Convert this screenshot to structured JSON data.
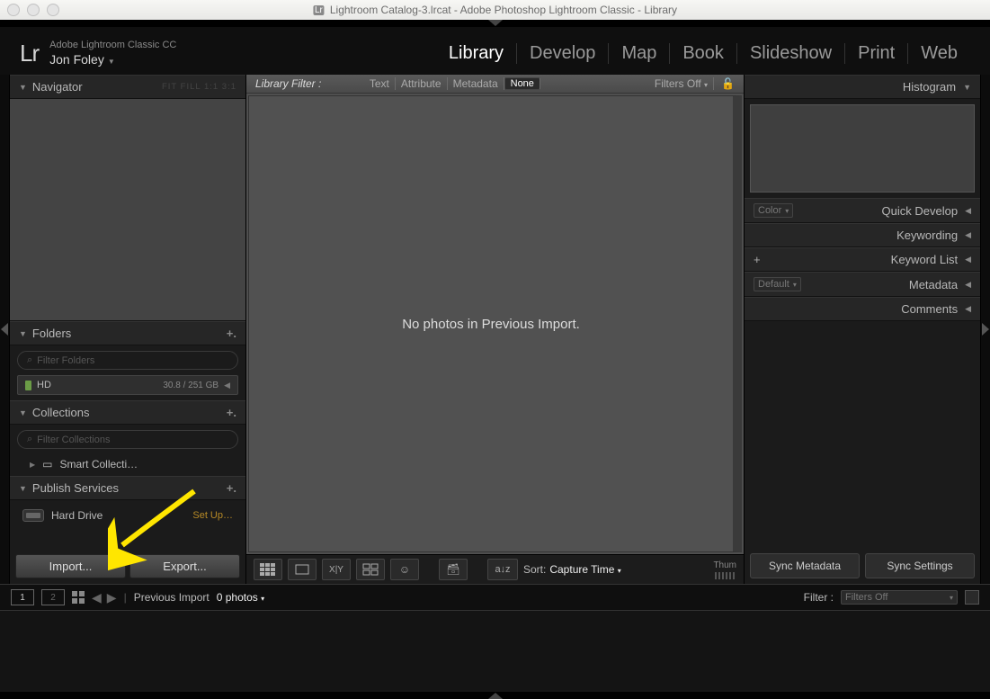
{
  "titlebar": "Lightroom Catalog-3.lrcat - Adobe Photoshop Lightroom Classic - Library",
  "product": "Adobe Lightroom Classic CC",
  "user": "Jon Foley",
  "modules": [
    "Library",
    "Develop",
    "Map",
    "Book",
    "Slideshow",
    "Print",
    "Web"
  ],
  "module_active": "Library",
  "left": {
    "navigator": {
      "title": "Navigator",
      "opts": "FIT  FILL  1:1  3:1"
    },
    "folders": {
      "title": "Folders",
      "filter_ph": "Filter Folders",
      "drive": {
        "name": "HD",
        "size": "30.8 / 251 GB"
      }
    },
    "collections": {
      "title": "Collections",
      "filter_ph": "Filter Collections",
      "smart": "Smart Collecti…"
    },
    "publish": {
      "title": "Publish Services",
      "hd": "Hard Drive",
      "setup": "Set Up…"
    },
    "import_btn": "Import...",
    "export_btn": "Export..."
  },
  "filterbar": {
    "label": "Library Filter :",
    "opts": [
      "Text",
      "Attribute",
      "Metadata",
      "None"
    ],
    "sel": "None",
    "filters_off": "Filters Off"
  },
  "center_msg": "No photos in Previous Import.",
  "toolbar": {
    "sort_label": "Sort:",
    "sort_value": "Capture Time",
    "thumb": "Thum"
  },
  "right": {
    "histogram": "Histogram",
    "quick": {
      "color_sel": "Color",
      "title": "Quick Develop"
    },
    "keywording": "Keywording",
    "keylist": "Keyword List",
    "metadata": {
      "sel": "Default",
      "title": "Metadata"
    },
    "comments": "Comments",
    "sync_meta": "Sync Metadata",
    "sync_set": "Sync Settings"
  },
  "filmbar": {
    "w1": "1",
    "w2": "2",
    "crumb": "Previous Import",
    "count": "0 photos",
    "filter_lbl": "Filter :",
    "filter_val": "Filters Off"
  }
}
